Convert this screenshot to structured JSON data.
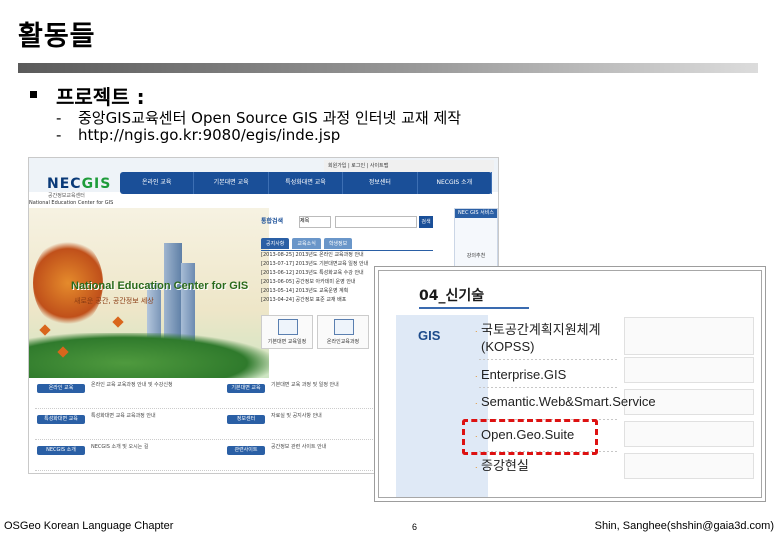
{
  "slide": {
    "title": "활동들",
    "bullet": "프로젝트 :",
    "sublines": [
      "중앙GIS교육센터 Open Source GIS 과정 인터넷 교재 제작",
      "http://ngis.go.kr:9080/egis/inde.jsp"
    ],
    "dash": "-"
  },
  "website": {
    "logo_main": "NEC",
    "logo_accent": "GIS",
    "logo_sub": "공간정보교육센터",
    "util_text": "회원가입 | 로그인 | 사이트맵",
    "nav": [
      "온라인 교육",
      "기본대면 교육",
      "특성화대면 교육",
      "정보센터",
      "NECGIS 소개"
    ],
    "breadcrumb": "National Education Center for GIS",
    "hero_title": "National Education Center for GIS",
    "hero_sub": "새로운 공간, 공간정보 세상",
    "search_label": "통합검색",
    "search_select": "제목",
    "search_button": "검색",
    "tabs": [
      "공지사항",
      "교육소식",
      "학생정보"
    ],
    "news": [
      "[2013-08-25] 2013년도 온라인 교육과정 안내",
      "[2013-07-17] 2013년도 기본대면교육 일정 안내",
      "[2013-06-12] 2013년도 특성화교육 수강 안내",
      "[2013-06-05] 공간정보 아카데미 운영 안내",
      "[2013-05-14] 2013년도 교육운영 계획",
      "[2013-04-24] 공간정보 표준 교재 배포"
    ],
    "quick": [
      "기본대면 교육일정",
      "온라인교육과정"
    ],
    "side_title": "NEC GIS 서비스",
    "side_item": "강의추천",
    "bottom_rows": [
      {
        "label": "온라인 교육",
        "text": "온라인 교육 교육과정 안내 및 수강신청",
        "label2": "기본대면 교육",
        "text2": "기본대면 교육 과정 및 일정 안내"
      },
      {
        "label": "특성화대면 교육",
        "text": "특성화대면 교육 교육과정 안내",
        "label2": "정보센터",
        "text2": "자료실 및 공지사항 안내"
      },
      {
        "label": "NECGIS 소개",
        "text": "NECGIS 소개 및 오시는 길",
        "label2": "관련사이트",
        "text2": "공간정보 관련 사이트 안내"
      }
    ]
  },
  "panel": {
    "title": "04_신기술",
    "category": "GIS",
    "items": [
      "국토공간계획지원체계(KOPSS)",
      "Enterprise.GIS",
      "Semantic.Web&Smart.Service",
      "Open.Geo.Suite",
      "증강현실"
    ],
    "bullet": "."
  },
  "footer": {
    "left": "OSGeo Korean Language Chapter",
    "center": "6",
    "right": "Shin, Sanghee(shshin@gaia3d.com)"
  },
  "colors": {
    "nav_blue": "#1a4f98",
    "highlight_red": "#dd1111",
    "gis_box": "#dfe9f6"
  }
}
